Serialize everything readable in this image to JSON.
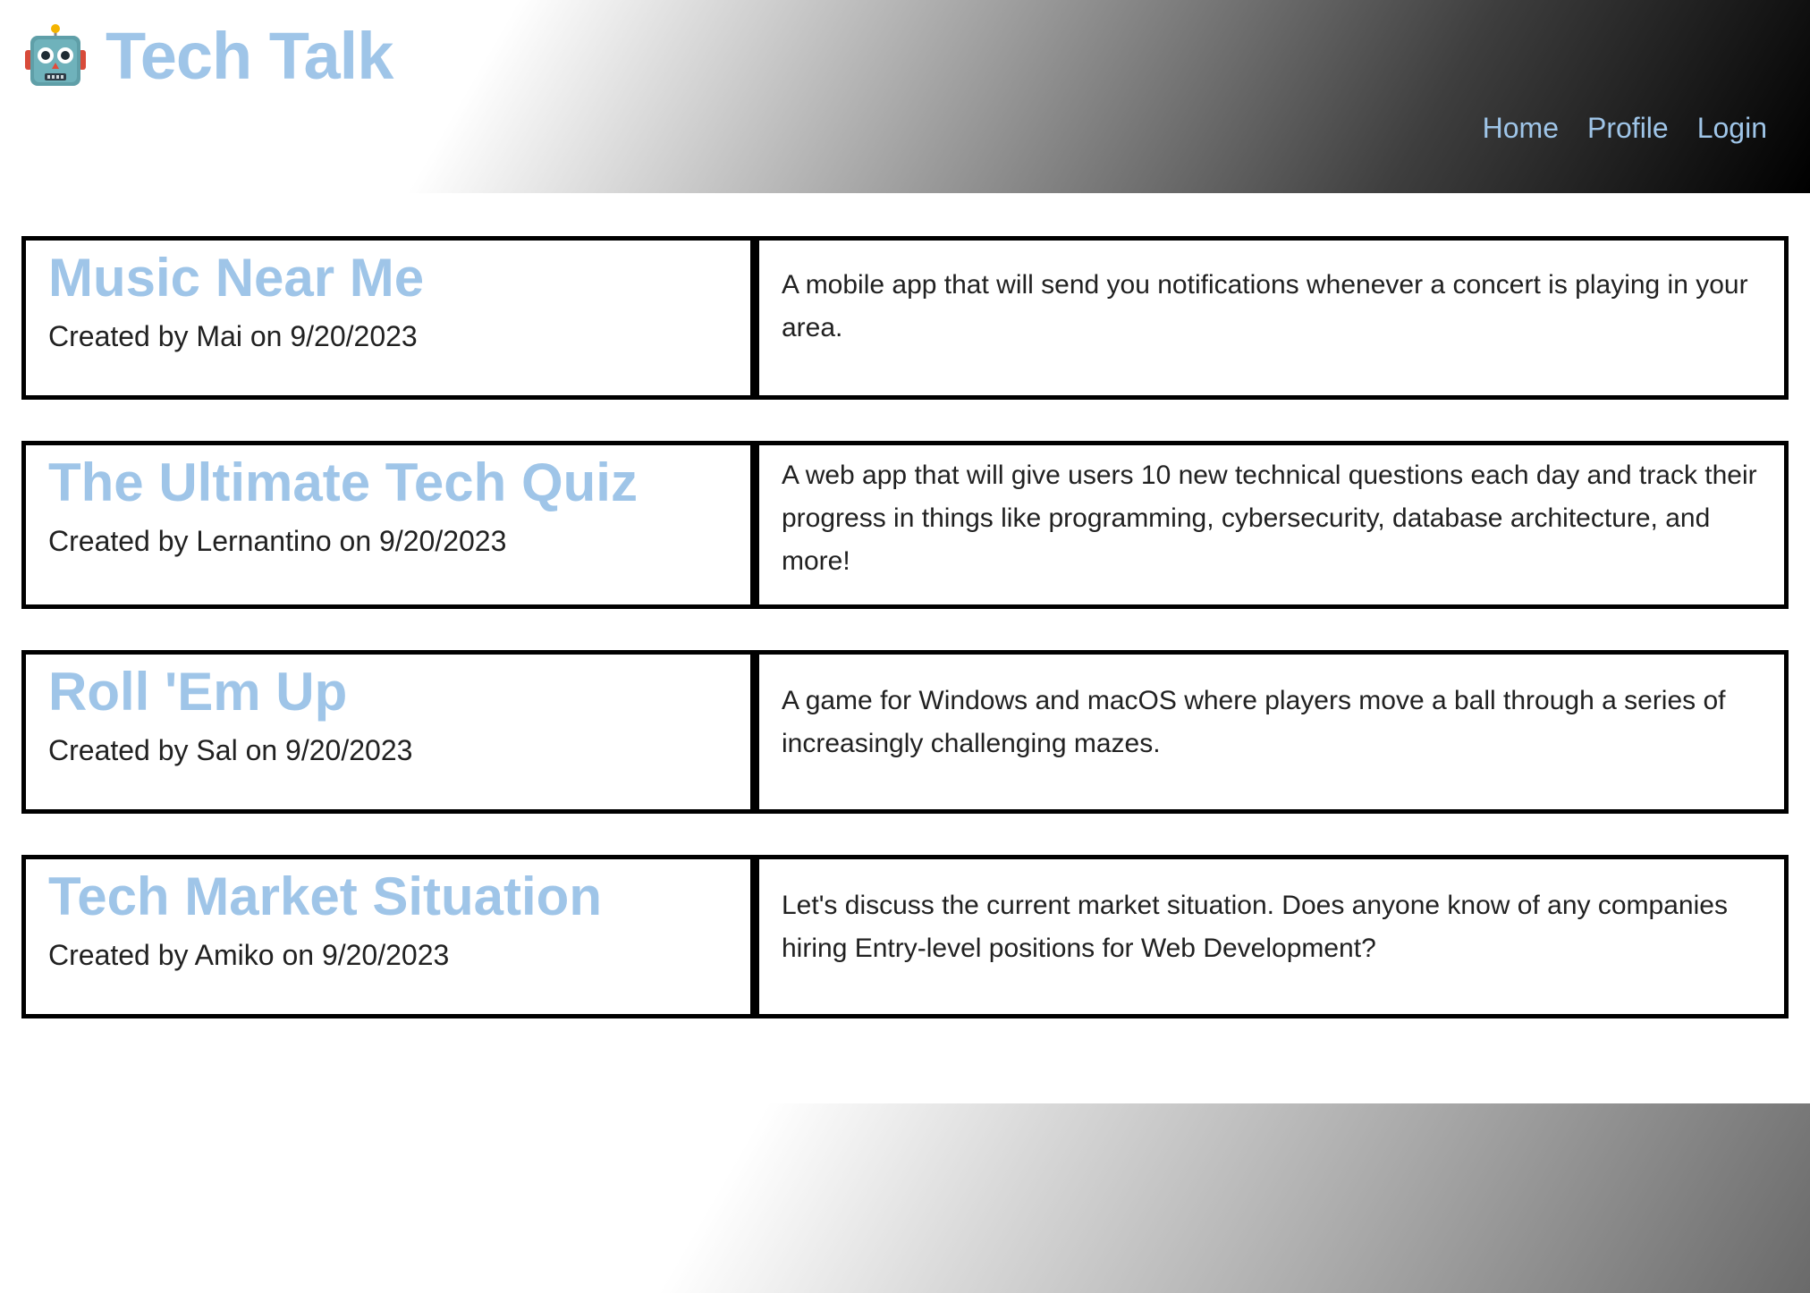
{
  "header": {
    "brand_icon": "robot-icon",
    "brand_title": "Tech Talk",
    "nav": [
      {
        "label": "Home"
      },
      {
        "label": "Profile"
      },
      {
        "label": "Login"
      }
    ]
  },
  "posts": [
    {
      "title": "Music Near Me",
      "meta": "Created by Mai on 9/20/2023",
      "description": "A mobile app that will send you notifications whenever a concert is playing in your area."
    },
    {
      "title": "The Ultimate Tech Quiz",
      "meta": "Created by Lernantino on 9/20/2023",
      "description": "A web app that will give users 10 new technical questions each day and track their progress in things like programming, cybersecurity, database architecture, and more!"
    },
    {
      "title": "Roll 'Em Up",
      "meta": "Created by Sal on 9/20/2023",
      "description": "A game for Windows and macOS where players move a ball through a series of increasingly challenging mazes."
    },
    {
      "title": "Tech Market Situation",
      "meta": "Created by Amiko on 9/20/2023",
      "description": "Let's discuss the current market situation. Does anyone know of any companies hiring Entry-level positions for Web Development?"
    }
  ],
  "colors": {
    "accent": "#9fc5e8",
    "text": "#212121",
    "border": "#000000"
  }
}
